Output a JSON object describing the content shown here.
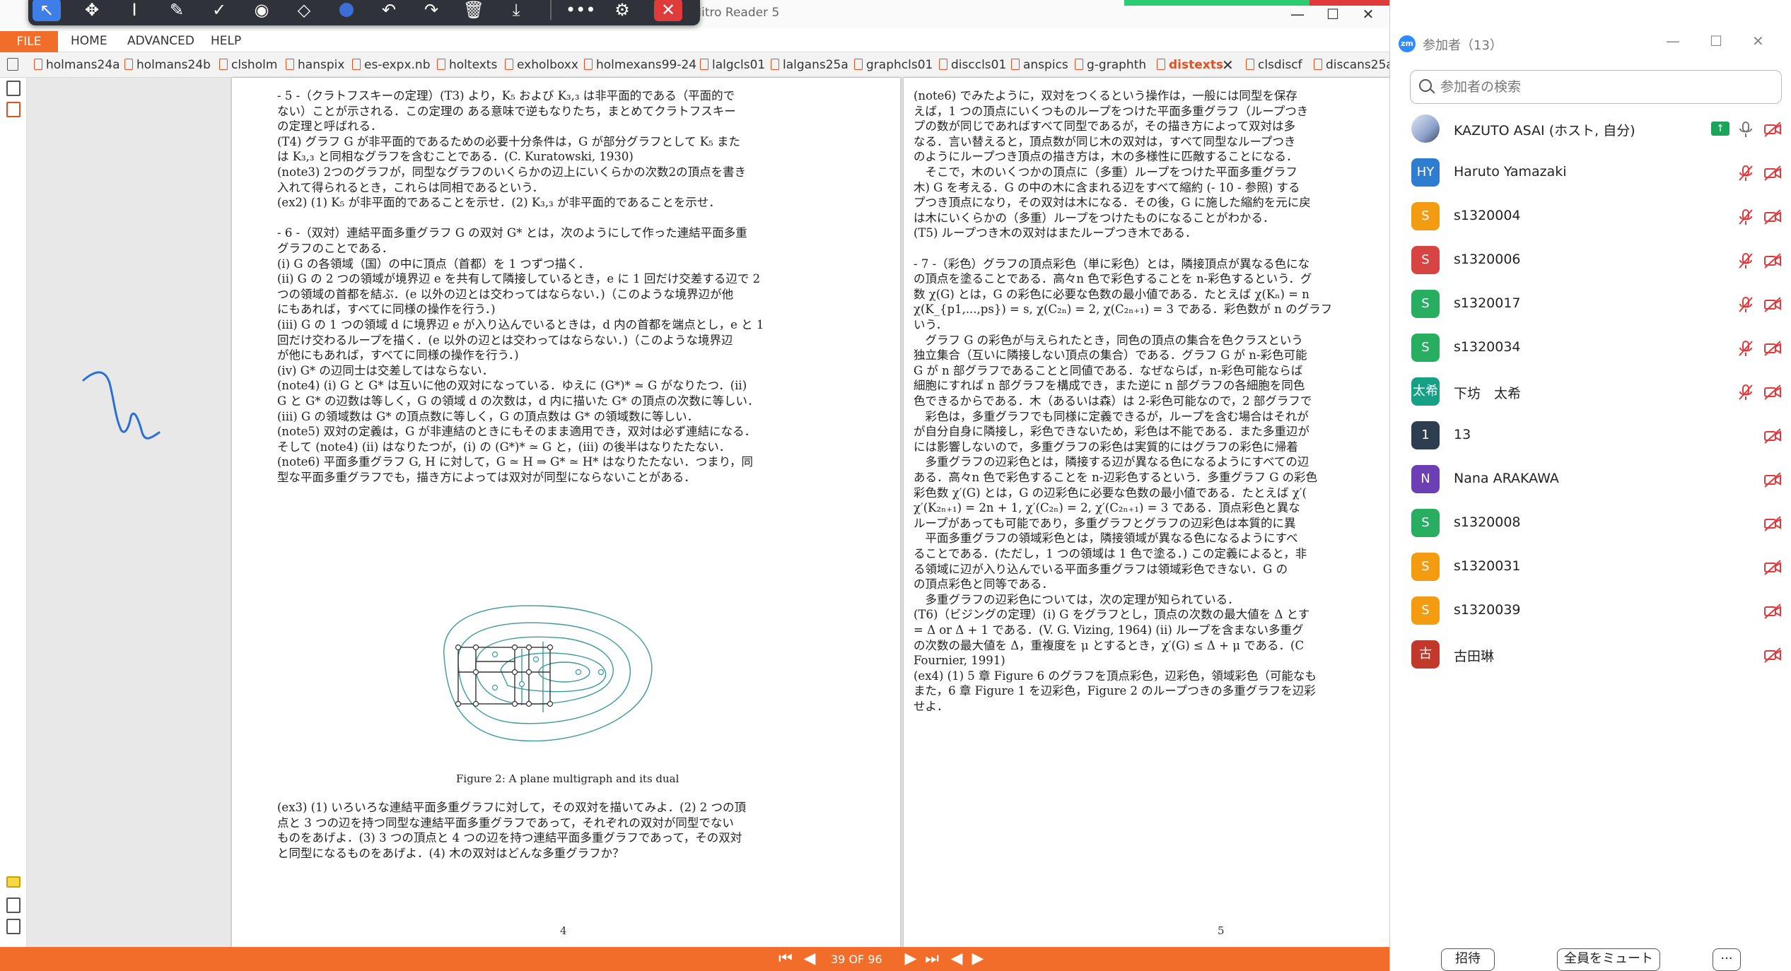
{
  "nitro": {
    "window_title": "distexts.pdf - Nitro Reader 5",
    "window_controls": {
      "minimize": "—",
      "maximize": "☐",
      "close": "✕"
    },
    "menu": {
      "file": "FILE",
      "home": "HOME",
      "advanced": "ADVANCED",
      "help": "HELP"
    },
    "tabs": [
      {
        "label": "holmans24a"
      },
      {
        "label": "holmans24b"
      },
      {
        "label": "clsholm"
      },
      {
        "label": "hanspix"
      },
      {
        "label": "es-expx.nb"
      },
      {
        "label": "holtexts"
      },
      {
        "label": "exholboxx"
      },
      {
        "label": "holmexans99-24"
      },
      {
        "label": "lalgcls01"
      },
      {
        "label": "lalgans25a"
      },
      {
        "label": "graphcls01"
      },
      {
        "label": "disccls01"
      },
      {
        "label": "anspics"
      },
      {
        "label": "g-graphth"
      },
      {
        "label": "distexts"
      },
      {
        "label": "clsdiscf"
      },
      {
        "label": "discans25a"
      }
    ],
    "active_tab": "distexts",
    "status": {
      "page_indicator": "39 OF 96"
    },
    "accent_color": "#f36d2a"
  },
  "pdf": {
    "page4": {
      "number": "4",
      "lines": [
        "- 5 -（クラトフスキーの定理）(T3) より，K₅ および K₃,₃ は非平面的である（平面的で",
        "ない）ことが示される．この定理の ある意味で逆もなりたち，まとめてクラトフスキー",
        "の定理と呼ばれる．",
        "(T4) グラフ G が非平面的であるための必要十分条件は，G が部分グラフとして K₅ また",
        "は K₃,₃ と同相なグラフを含むことである．(C. Kuratowski, 1930)",
        "(note3) 2つのグラフが，同型なグラフのいくらかの辺上にいくらかの次数2の頂点を書き",
        "入れて得られるとき，これらは同相であるという．",
        "(ex2) (1) K₅ が非平面的であることを示せ．(2) K₃,₃ が非平面的であることを示せ．",
        "",
        "- 6 -（双対）連結平面多重グラフ G の双対 G* とは，次のようにして作った連結平面多重",
        "グラフのことである．",
        "(i) G の各領域（国）の中に頂点（首都）を 1 つずつ描く．",
        "(ii) G の 2 つの領域が境界辺 e を共有して隣接しているとき，e に 1 回だけ交差する辺で 2",
        "つの領域の首都を結ぶ．(e 以外の辺とは交わってはならない．)（このような境界辺が他",
        "にもあれば，すべてに同様の操作を行う．)",
        "(iii) G の 1 つの領域 d に境界辺 e が入り込んでいるときは，d 内の首都を端点とし，e と 1",
        "回だけ交わるループを描く．(e 以外の辺とは交わってはならない．)（このような境界辺",
        "が他にもあれば，すべてに同様の操作を行う．)",
        "(iv) G* の辺同士は交差してはならない．",
        "(note4) (i) G と G* は互いに他の双対になっている．ゆえに (G*)* ≃ G がなりたつ．(ii)",
        "G と G* の辺数は等しく，G の領域 d の次数は，d 内に描いた G* の頂点の次数に等しい．",
        "(iii) G の領域数は G* の頂点数に等しく，G の頂点数は G* の領域数に等しい．",
        "(note5) 双対の定義は，G が非連結のときにもそのまま適用でき，双対は必ず連結になる．",
        "そして (note4) (ii) はなりたつが，(i) の (G*)* ≃ G と，(iii) の後半はなりたたない．",
        "(note6) 平面多重グラフ G, H に対して，G ≃ H ⇒ G* ≃ H* はなりたたない．つまり，同",
        "型な平面多重グラフでも，描き方によっては双対が同型にならないことがある．"
      ],
      "caption": "Figure 2: A plane multigraph and its dual",
      "bottom_lines": [
        "(ex3) (1) いろいろな連結平面多重グラフに対して，その双対を描いてみよ．(2) 2 つの頂",
        "点と 3 つの辺を持つ同型な連結平面多重グラフであって，それぞれの双対が同型でない",
        "ものをあげよ．(3) 3 つの頂点と 4 つの辺を持つ連結平面多重グラフであって，その双対",
        "と同型になるものをあげよ．(4) 木の双対はどんな多重グラフか？"
      ]
    },
    "page5": {
      "number": "5",
      "lines": [
        "(note6) でみたように，双対をつくるという操作は，一般には同型を保存",
        "えば，1 つの頂点にいくつものループをつけた平面多重グラフ（ループつき",
        "プの数が同じであればすべて同型であるが，その描き方によって双対は多",
        "なる．言い替えると，頂点数が同じ木の双対は，すべて同型なループつき",
        "のようにループつき頂点の描き方は，木の多様性に匹敵することになる．",
        "　そこで，木のいくつかの頂点に（多重）ループをつけた平面多重グラフ",
        "木) G を考える．G の中の木に含まれる辺をすべて縮約 (- 10 - 参照) する",
        "プつき頂点になり，その双対は木になる．その後，G に施した縮約を元に戻",
        "は木にいくらかの（多重）ループをつけたものになることがわかる．",
        "(T5) ループつき木の双対はまたループつき木である．",
        "",
        "- 7 -（彩色）グラフの頂点彩色（単に彩色）とは，隣接頂点が異なる色にな",
        "の頂点を塗ることである．高々n 色で彩色することを n-彩色するという．グ",
        "数 χ(G) とは，G の彩色に必要な色数の最小値である．たとえば χ(Kₙ) = n",
        "χ(K_{p1,...,ps}) = s, χ(C₂ₙ) = 2, χ(C₂ₙ₊₁) = 3 である．彩色数が n のグラフ",
        "いう．",
        "　グラフ G の彩色が与えられたとき，同色の頂点の集合を色クラスという",
        "独立集合（互いに隣接しない頂点の集合）である．グラフ G が n-彩色可能",
        "G が n 部グラフであることと同値である．なぜならば，n-彩色可能ならば",
        "細胞にすれば n 部グラフを構成でき，また逆に n 部グラフの各細胞を同色",
        "色できるからである．木（あるいは森）は 2-彩色可能なので，2 部グラフで",
        "　彩色は，多重グラフでも同様に定義できるが，ループを含む場合はそれが",
        "が自分自身に隣接し，彩色できないため，彩色は不能である．また多重辺が",
        "には影響しないので，多重グラフの彩色は実質的にはグラフの彩色に帰着",
        "　多重グラフの辺彩色とは，隣接する辺が異なる色になるようにすべての辺",
        "ある．高々n 色で彩色することを n-辺彩色するという．多重グラフ G の彩色",
        "彩色数 χ′(G) とは，G の辺彩色に必要な色数の最小値である．たとえば χ′(",
        "χ′(K₂ₙ₊₁) = 2n + 1, χ′(C₂ₙ) = 2, χ′(C₂ₙ₊₁) = 3 である．頂点彩色と異な",
        "ループがあっても可能であり，多重グラフとグラフの辺彩色は本質的に異",
        "　平面多重グラフの領域彩色とは，隣接領域が異なる色になるようにすべ",
        "ることである．(ただし，1 つの領域は 1 色で塗る．) この定義によると，非",
        "る領域に辺が入り込んでいる平面多重グラフは領域彩色できない．G の",
        "の頂点彩色と同等である．",
        "　多重グラフの辺彩色については，次の定理が知られている．",
        "(T6)（ビジングの定理）(i) G をグラフとし，頂点の次数の最大値を Δ とす",
        "= Δ or Δ + 1 である．(V. G. Vizing, 1964) (ii) ループを含まない多重グ",
        "の次数の最大値を Δ，重複度を μ とするとき，χ′(G) ≤ Δ + μ である．(C",
        "Fournier, 1991)",
        "(ex4) (1) 5 章 Figure 6 のグラフを頂点彩色，辺彩色，領域彩色（可能なも",
        "また，6 章 Figure 1 を辺彩色，Figure 2 のループつきの多重グラフを辺彩",
        "せよ．"
      ]
    }
  },
  "zoom": {
    "title": "参加者（13）",
    "logo": "zm",
    "search_placeholder": "参加者の検索",
    "participants": [
      {
        "name": "KAZUTO ASAI (ホスト, 自分)",
        "initials": "",
        "color": "#6b7da8",
        "mic": "on",
        "video": "off",
        "sharing": true
      },
      {
        "name": "Haruto Yamazaki",
        "initials": "HY",
        "color": "#2f7dd1",
        "mic": "off",
        "video": "off"
      },
      {
        "name": "s1320004",
        "initials": "S",
        "color": "#f39c12",
        "mic": "off",
        "video": "off"
      },
      {
        "name": "s1320006",
        "initials": "S",
        "color": "#d64541",
        "mic": "off",
        "video": "off"
      },
      {
        "name": "s1320017",
        "initials": "S",
        "color": "#27ae60",
        "mic": "off",
        "video": "off"
      },
      {
        "name": "s1320034",
        "initials": "S",
        "color": "#27ae60",
        "mic": "off",
        "video": "off"
      },
      {
        "name": "下坊　太希",
        "initials": "太希",
        "color": "#16a085",
        "mic": "off",
        "video": "off"
      },
      {
        "name": "13",
        "initials": "1",
        "color": "#2c3e50",
        "mic": "none",
        "video": "off"
      },
      {
        "name": "Nana ARAKAWA",
        "initials": "N",
        "color": "#6c3fb5",
        "mic": "none",
        "video": "off"
      },
      {
        "name": "s1320008",
        "initials": "S",
        "color": "#27ae60",
        "mic": "none",
        "video": "off"
      },
      {
        "name": "s1320031",
        "initials": "S",
        "color": "#f39c12",
        "mic": "none",
        "video": "off"
      },
      {
        "name": "s1320039",
        "initials": "S",
        "color": "#f39c12",
        "mic": "none",
        "video": "off"
      },
      {
        "name": "古田琳",
        "initials": "古",
        "color": "#c0392b",
        "mic": "none",
        "video": "off"
      }
    ],
    "footer": {
      "invite": "招待",
      "mute_all": "全員をミュート",
      "more": "···"
    }
  }
}
